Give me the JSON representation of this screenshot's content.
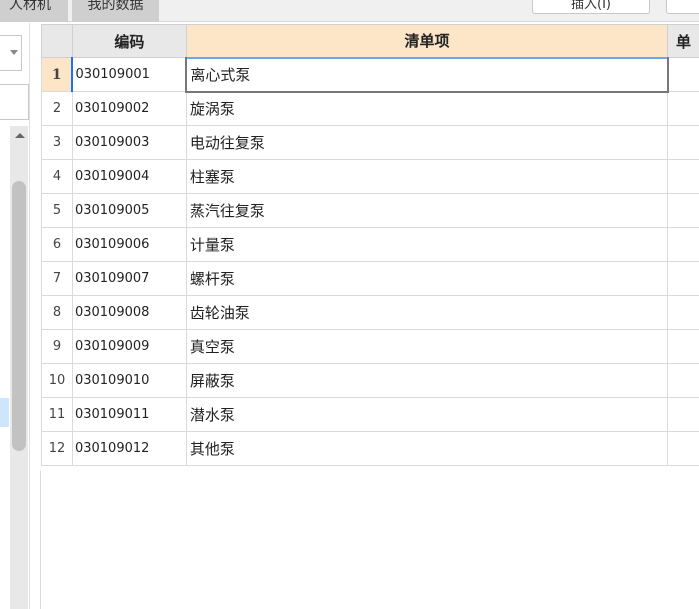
{
  "tabs": [
    {
      "label": "人材机"
    },
    {
      "label": "我的数据"
    }
  ],
  "toolbar": {
    "insert_label": "插入(I)",
    "other_label": ""
  },
  "grid": {
    "columns": [
      "",
      "编码",
      "清单项",
      "单"
    ],
    "rows": [
      {
        "n": "1",
        "code": "030109001",
        "name": "离心式泵"
      },
      {
        "n": "2",
        "code": "030109002",
        "name": "旋涡泵"
      },
      {
        "n": "3",
        "code": "030109003",
        "name": "电动往复泵"
      },
      {
        "n": "4",
        "code": "030109004",
        "name": "柱塞泵"
      },
      {
        "n": "5",
        "code": "030109005",
        "name": "蒸汽往复泵"
      },
      {
        "n": "6",
        "code": "030109006",
        "name": "计量泵"
      },
      {
        "n": "7",
        "code": "030109007",
        "name": "螺杆泵"
      },
      {
        "n": "8",
        "code": "030109008",
        "name": "齿轮油泵"
      },
      {
        "n": "9",
        "code": "030109009",
        "name": "真空泵"
      },
      {
        "n": "10",
        "code": "030109010",
        "name": "屏蔽泵"
      },
      {
        "n": "11",
        "code": "030109011",
        "name": "潜水泵"
      },
      {
        "n": "12",
        "code": "030109012",
        "name": "其他泵"
      }
    ]
  }
}
